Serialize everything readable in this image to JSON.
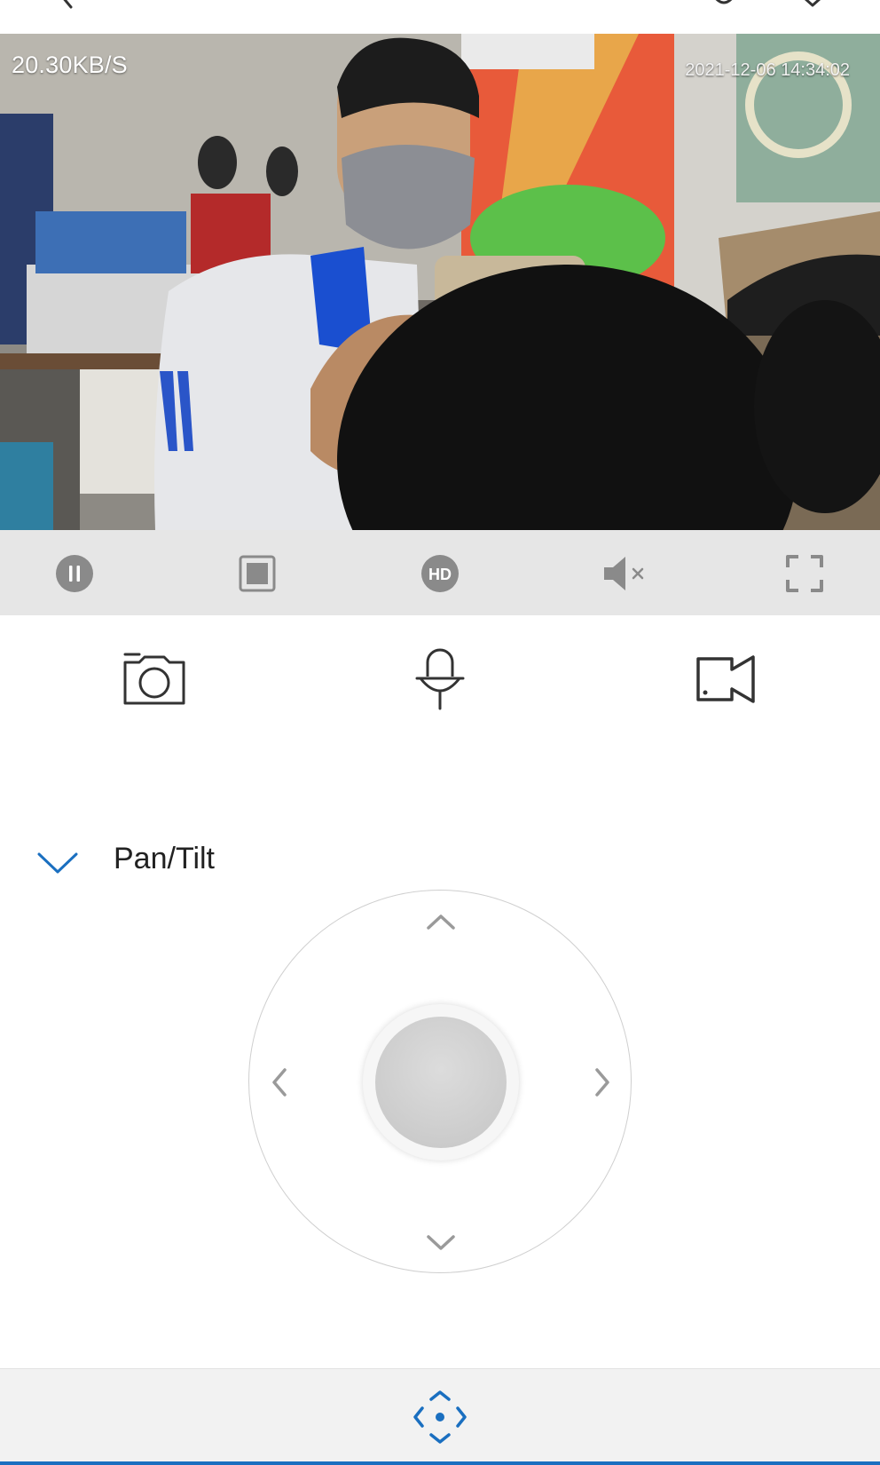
{
  "video": {
    "speed": "20.30KB/S",
    "timestamp": "2021-12-06 14:34:02"
  },
  "controls": {
    "items": [
      {
        "name": "pause",
        "icon": "pause-icon"
      },
      {
        "name": "stop",
        "icon": "stop-icon"
      },
      {
        "name": "quality",
        "icon": "hd-icon",
        "text": "HD"
      },
      {
        "name": "mute",
        "icon": "mute-icon"
      },
      {
        "name": "fullscreen",
        "icon": "fullscreen-icon"
      }
    ]
  },
  "actions": {
    "items": [
      {
        "name": "snapshot",
        "icon": "camera-icon"
      },
      {
        "name": "talk",
        "icon": "microphone-icon"
      },
      {
        "name": "record",
        "icon": "video-camera-icon"
      }
    ]
  },
  "pantilt": {
    "label": "Pan/Tilt",
    "expanded": true
  },
  "bottom_tab": {
    "icon": "ptz-direction-icon",
    "active": true
  },
  "colors": {
    "accent": "#1a6fc0",
    "control_bar": "#e6e6e6",
    "icon_gray": "#8a8a8a",
    "icon_dark": "#333333"
  }
}
